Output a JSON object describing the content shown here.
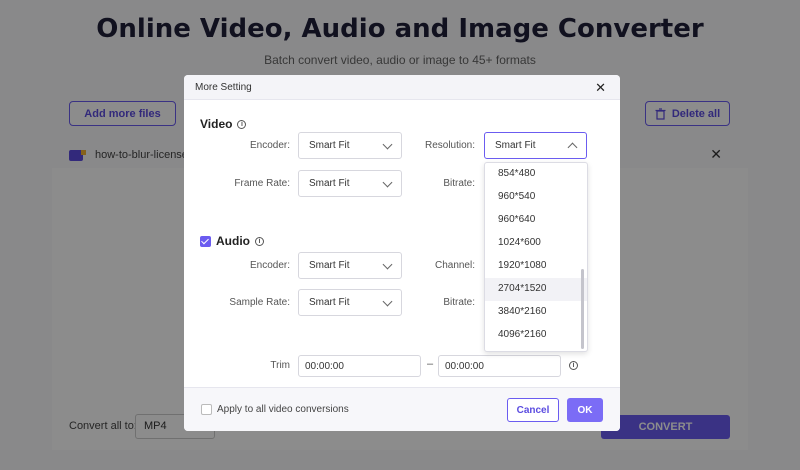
{
  "page": {
    "title": "Online Video, Audio and Image Converter",
    "subtitle": "Batch convert video, audio or image to 45+ formats",
    "add_files_label": "Add more files",
    "delete_all_label": "Delete all",
    "file_name": "how-to-blur-license",
    "convert_all_label": "Convert all to:",
    "format_value": "MP4",
    "convert_label": "CONVERT"
  },
  "modal": {
    "title": "More Setting",
    "video": {
      "title": "Video",
      "encoder_label": "Encoder:",
      "encoder_value": "Smart Fit",
      "resolution_label": "Resolution:",
      "resolution_value": "Smart Fit",
      "frame_rate_label": "Frame Rate:",
      "frame_rate_value": "Smart Fit",
      "bitrate_label": "Bitrate:"
    },
    "audio": {
      "title": "Audio",
      "checked": true,
      "encoder_label": "Encoder:",
      "encoder_value": "Smart Fit",
      "channel_label": "Channel:",
      "sample_rate_label": "Sample Rate:",
      "sample_rate_value": "Smart Fit",
      "bitrate_label": "Bitrate:"
    },
    "trim": {
      "label": "Trim",
      "start": "00:00:00",
      "separator": "–",
      "end": "00:00:00"
    },
    "footer": {
      "apply_all_label": "Apply to all video conversions",
      "cancel_label": "Cancel",
      "ok_label": "OK"
    }
  },
  "resolution_options": [
    "854*480",
    "960*540",
    "960*640",
    "1024*600",
    "1920*1080",
    "2704*1520",
    "3840*2160",
    "4096*2160"
  ],
  "highlighted_option": "2704*1520",
  "colors": {
    "accent": "#6b5cf0",
    "overlay": "rgba(0,0,0,0.45)"
  }
}
